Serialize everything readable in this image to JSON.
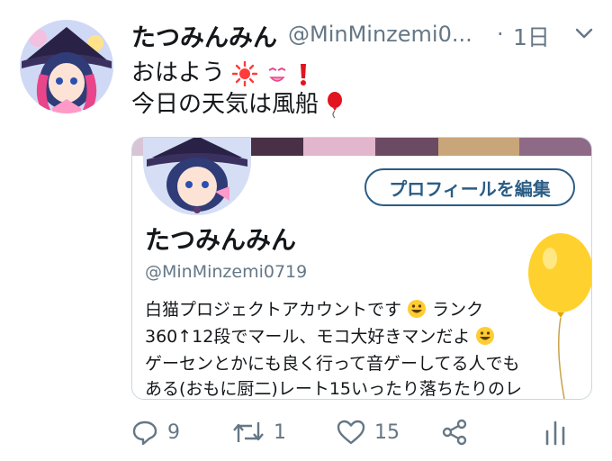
{
  "tweet": {
    "display_name": "たつみんみん",
    "handle": "@MinMinzemi0...",
    "separator": "·",
    "time": "1日",
    "lines": [
      "おはよう",
      "今日の天気は風船"
    ]
  },
  "card": {
    "edit_profile_label": "プロフィールを編集",
    "name": "たつみんみん",
    "handle": "@MinMinzemi0719",
    "bio_lines": [
      "白猫プロジェクトアカウントです",
      "ランク",
      "360↑12段でマール、モコ大好きマンだよ",
      "ゲーセンとかにも良く行って音ゲーしてる人でも",
      "ある(おもに厨二)レート15いったり落ちたりのレ"
    ]
  },
  "actions": {
    "reply_count": "9",
    "retweet_count": "1",
    "like_count": "15"
  },
  "colors": {
    "text": "#14171a",
    "secondary": "#657786",
    "button_border": "#2b5d85",
    "balloon": "#ffd12e",
    "sun": "#ff3b3b"
  },
  "icons": [
    "chevron-down-icon",
    "sun-emoji",
    "smirk-emoji",
    "exclamation-emoji",
    "balloon-emoji",
    "grin-emoji",
    "reply-icon",
    "retweet-icon",
    "like-icon",
    "share-icon",
    "analytics-icon"
  ]
}
